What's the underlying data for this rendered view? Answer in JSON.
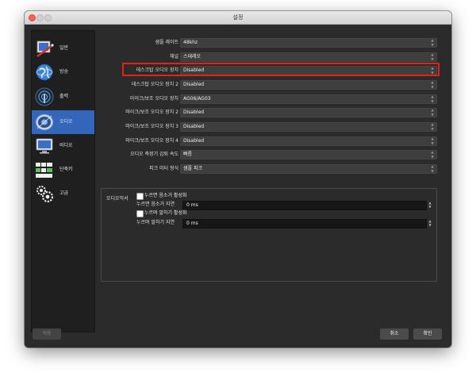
{
  "window": {
    "title": "설정"
  },
  "sidebar": {
    "items": [
      {
        "label": "일반",
        "icon": "general-icon",
        "active": false
      },
      {
        "label": "방송",
        "icon": "stream-icon",
        "active": false
      },
      {
        "label": "출력",
        "icon": "output-icon",
        "active": false
      },
      {
        "label": "오디오",
        "icon": "audio-icon",
        "active": true
      },
      {
        "label": "비디오",
        "icon": "video-icon",
        "active": false
      },
      {
        "label": "단축키",
        "icon": "hotkeys-icon",
        "active": false
      },
      {
        "label": "고급",
        "icon": "advanced-gear-icon",
        "active": false
      }
    ]
  },
  "audio": {
    "settings": [
      {
        "label": "샘플 레이트",
        "value": "48khz"
      },
      {
        "label": "채널",
        "value": "스테레오"
      },
      {
        "label": "데스크탑 오디오 장치",
        "value": "Disabled"
      },
      {
        "label": "데스크탑 오디오 장치 2",
        "value": "Disabled"
      },
      {
        "label": "마이크/보조 오디오 장치",
        "value": "AG06/AG03"
      },
      {
        "label": "마이크/보조 오디오 장치 2",
        "value": "Disabled"
      },
      {
        "label": "마이크/보조 오디오 장치 3",
        "value": "Disabled"
      },
      {
        "label": "마이크/보조 오디오 장치 4",
        "value": "Disabled"
      },
      {
        "label": "오디오 측정기 감퇴 속도",
        "value": "빠름"
      },
      {
        "label": "피크 미터 형식",
        "value": "샘플 피크"
      }
    ],
    "mixer": {
      "label": "오디오믹서",
      "push_to_mute_label": "누르면 음소거 활성화",
      "push_to_mute_delay_label": "누르면 음소거 지연",
      "push_to_mute_delay_value": "0 ms",
      "push_to_talk_label": "누르며 말하기 활성화",
      "push_to_talk_delay_label": "누르며 말하기 지연",
      "push_to_talk_delay_value": "0 ms"
    }
  },
  "buttons": {
    "apply": "적용",
    "cancel": "취소",
    "ok": "확인"
  },
  "colors": {
    "active_sidebar": "#3366bb",
    "highlight": "#e2221b"
  }
}
